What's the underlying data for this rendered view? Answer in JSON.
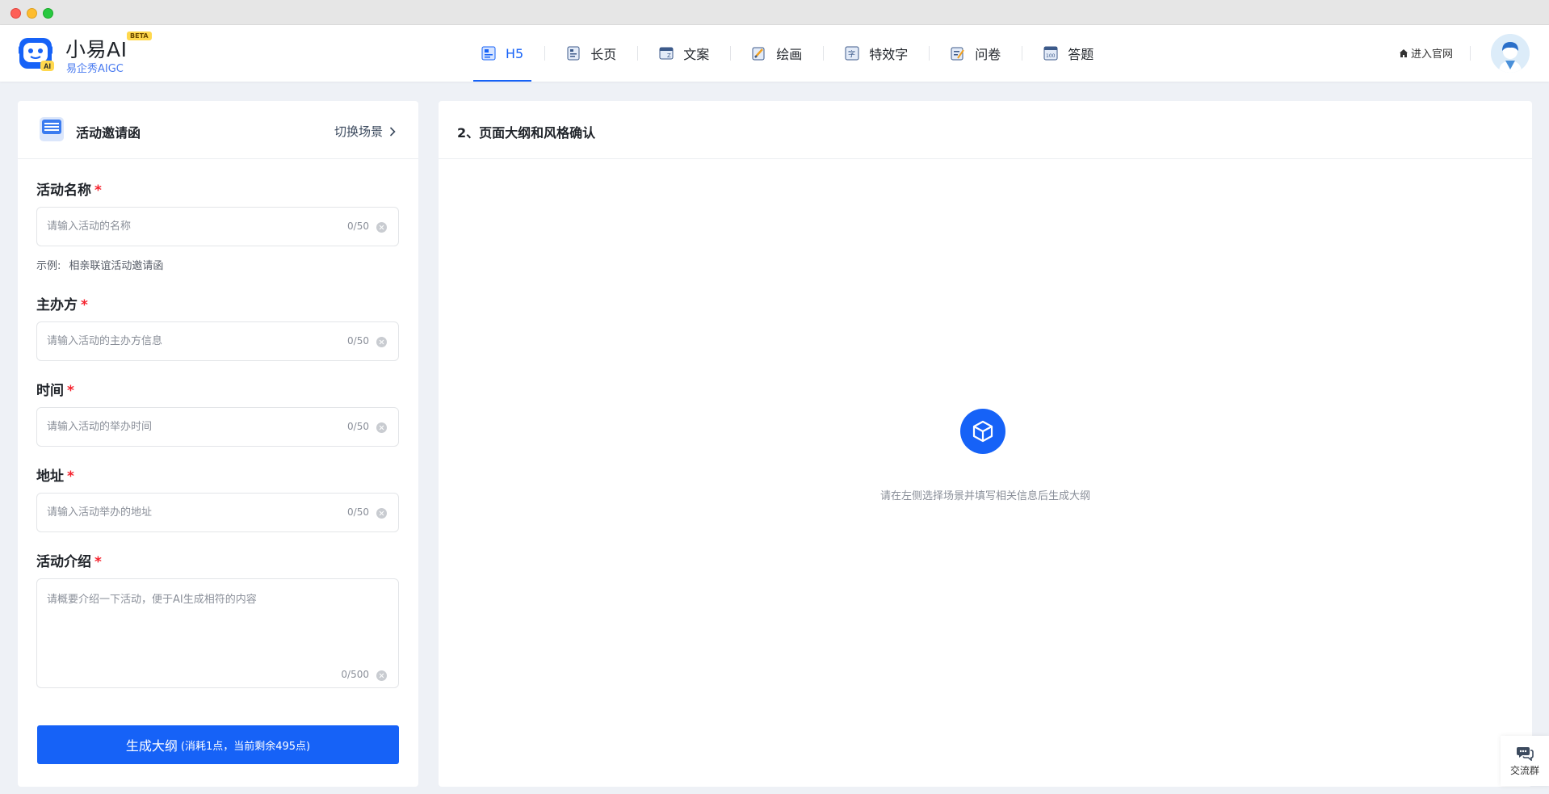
{
  "app": {
    "brand_name": "小易AI",
    "beta": "BETA",
    "brand_sub": "易企秀AIGC"
  },
  "nav": {
    "items": [
      {
        "label": "H5",
        "icon": "h5-icon",
        "active": true
      },
      {
        "label": "长页",
        "icon": "long-page-icon"
      },
      {
        "label": "文案",
        "icon": "copywriting-icon"
      },
      {
        "label": "绘画",
        "icon": "painting-icon"
      },
      {
        "label": "特效字",
        "icon": "effect-text-icon"
      },
      {
        "label": "问卷",
        "icon": "survey-icon"
      },
      {
        "label": "答题",
        "icon": "quiz-icon"
      }
    ],
    "official_site": "进入官网"
  },
  "left_panel": {
    "scene_title": "活动邀请函",
    "switch_scene": "切换场景",
    "fields": {
      "name": {
        "label": "活动名称",
        "required": "*",
        "placeholder": "请输入活动的名称",
        "counter": "0/50"
      },
      "organizer": {
        "label": "主办方",
        "required": "*",
        "placeholder": "请输入活动的主办方信息",
        "counter": "0/50"
      },
      "time": {
        "label": "时间",
        "required": "*",
        "placeholder": "请输入活动的举办时间",
        "counter": "0/50"
      },
      "address": {
        "label": "地址",
        "required": "*",
        "placeholder": "请输入活动举办的地址",
        "counter": "0/50"
      },
      "intro": {
        "label": "活动介绍",
        "required": "*",
        "placeholder": "请概要介绍一下活动，便于AI生成相符的内容",
        "counter": "0/500"
      }
    },
    "example_label": "示例:",
    "example_value": "相亲联谊活动邀请函",
    "generate_button": "生成大纲",
    "generate_cost": "(消耗1点，当前剩余495点)"
  },
  "right_panel": {
    "title": "2、页面大纲和风格确认",
    "empty_text": "请在左侧选择场景并填写相关信息后生成大纲"
  },
  "floating": {
    "group_label": "交流群"
  },
  "colors": {
    "accent": "#1662f7",
    "required": "#f5222d",
    "background": "#eef1f6"
  }
}
